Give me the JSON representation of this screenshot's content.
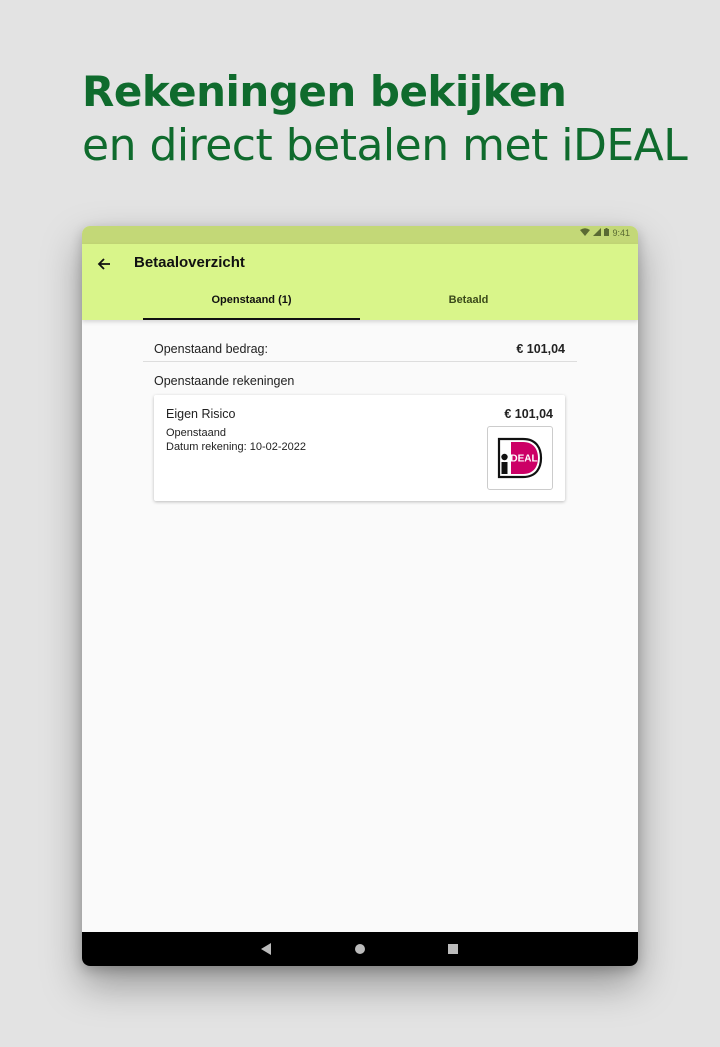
{
  "headline": {
    "line1": "Rekeningen bekijken",
    "line2": "en direct betalen met iDEAL"
  },
  "status_bar": {
    "time": "9:41",
    "icons": [
      "wifi-icon",
      "signal-icon",
      "battery-icon"
    ]
  },
  "app_bar": {
    "back_icon": "arrow-back-icon",
    "title": "Betaaloverzicht",
    "tabs": [
      {
        "label": "Openstaand (1)",
        "selected": true
      },
      {
        "label": "Betaald",
        "selected": false
      }
    ]
  },
  "summary": {
    "label": "Openstaand bedrag:",
    "amount": "€ 101,04"
  },
  "section_title": "Openstaande rekeningen",
  "invoices": [
    {
      "name": "Eigen Risico",
      "amount": "€ 101,04",
      "status": "Openstaand",
      "date": "Datum rekening: 10-02-2022",
      "pay_button": "ideal-logo-icon"
    }
  ],
  "nav_bar": [
    "nav-back-icon",
    "nav-home-icon",
    "nav-recents-icon"
  ],
  "colors": {
    "headline": "#0f6b2d",
    "app_bar": "#d9f58a",
    "status_bar": "#c3d877",
    "ideal_pink": "#cc0066"
  }
}
